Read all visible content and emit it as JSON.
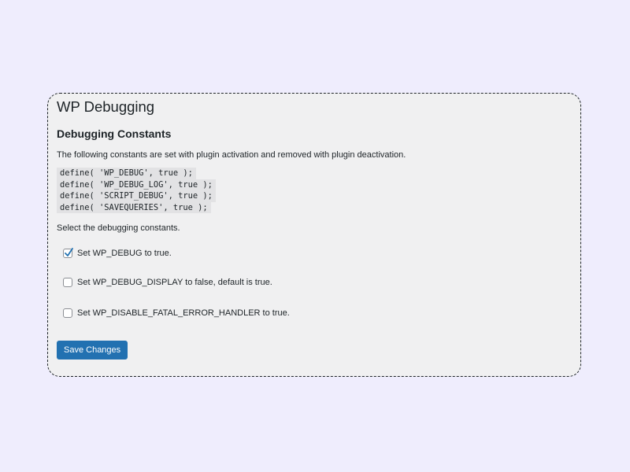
{
  "page": {
    "title": "WP Debugging"
  },
  "section": {
    "title": "Debugging Constants",
    "description": "The following constants are set with plugin activation and removed with plugin deactivation.",
    "code_lines": [
      "define( 'WP_DEBUG', true );",
      "define( 'WP_DEBUG_LOG', true );",
      "define( 'SCRIPT_DEBUG', true );",
      "define( 'SAVEQUERIES', true );"
    ],
    "instruction": "Select the debugging constants."
  },
  "options": [
    {
      "label": "Set WP_DEBUG to true.",
      "checked": true
    },
    {
      "label": "Set WP_DEBUG_DISPLAY to false, default is true.",
      "checked": false
    },
    {
      "label": "Set WP_DISABLE_FATAL_ERROR_HANDLER to true.",
      "checked": false
    }
  ],
  "actions": {
    "save_label": "Save Changes"
  },
  "colors": {
    "background": "#efedfd",
    "panel": "#f0f0f1",
    "accent": "#2271b1",
    "code_bg": "#e2e2e4"
  }
}
